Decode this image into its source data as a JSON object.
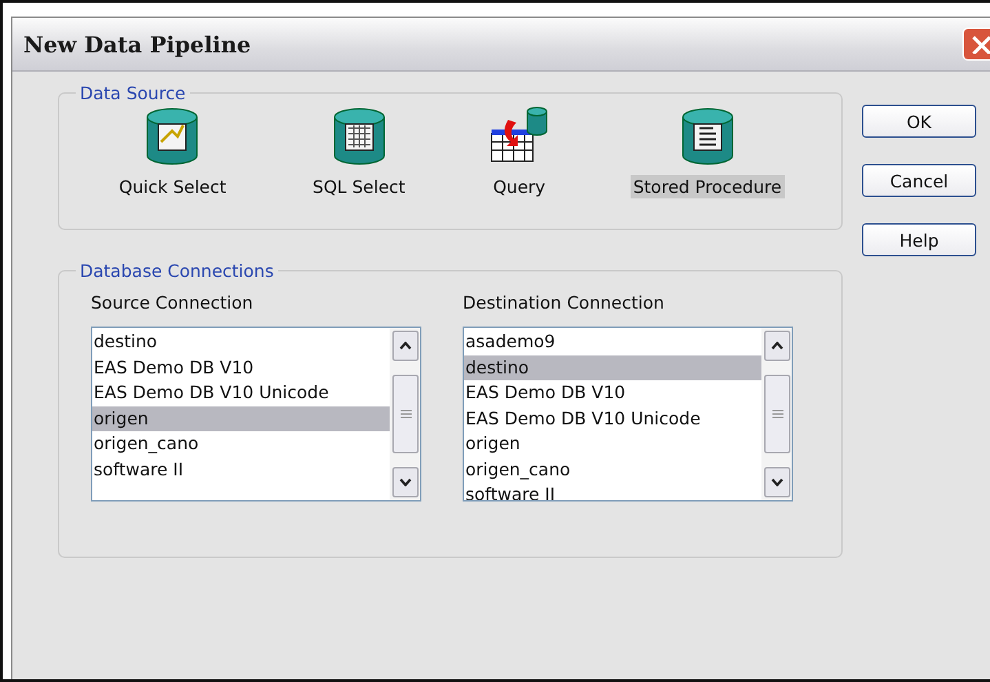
{
  "window": {
    "title": "New Data Pipeline"
  },
  "data_source": {
    "title": "Data Source",
    "options": [
      {
        "label": "Quick Select",
        "kind": "quick",
        "selected": false
      },
      {
        "label": "SQL Select",
        "kind": "sql",
        "selected": false
      },
      {
        "label": "Query",
        "kind": "query",
        "selected": false
      },
      {
        "label": "Stored Procedure",
        "kind": "stored",
        "selected": true
      }
    ]
  },
  "buttons": [
    "OK",
    "Cancel",
    "Help"
  ],
  "connections": {
    "title": "Database Connections",
    "source": {
      "label": "Source Connection",
      "items": [
        {
          "text": "destino",
          "selected": false
        },
        {
          "text": "EAS Demo DB V10",
          "selected": false
        },
        {
          "text": "EAS Demo DB V10 Unicode",
          "selected": false
        },
        {
          "text": "origen",
          "selected": true
        },
        {
          "text": "origen_cano",
          "selected": false
        },
        {
          "text": "software II",
          "selected": false
        }
      ]
    },
    "destination": {
      "label": "Destination Connection",
      "items": [
        {
          "text": "asademo9",
          "selected": false
        },
        {
          "text": "destino",
          "selected": true
        },
        {
          "text": "EAS Demo DB V10",
          "selected": false
        },
        {
          "text": "EAS Demo DB V10 Unicode",
          "selected": false
        },
        {
          "text": "origen",
          "selected": false
        },
        {
          "text": "origen_cano",
          "selected": false
        },
        {
          "text": "software II",
          "selected": false
        }
      ]
    }
  }
}
